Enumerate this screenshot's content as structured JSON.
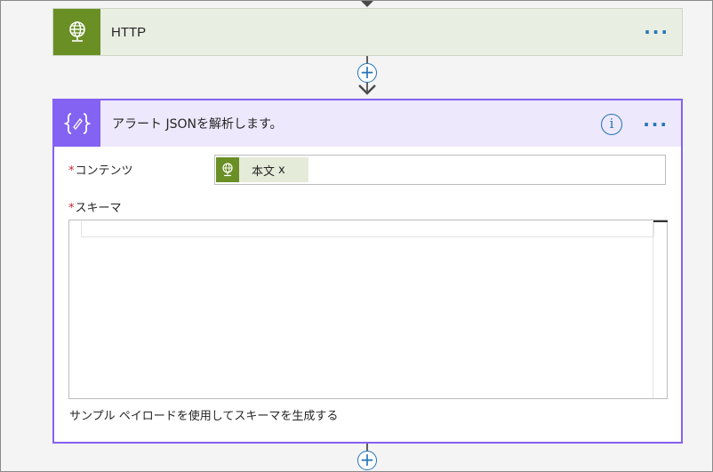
{
  "http_action": {
    "title": "HTTP",
    "icon": "globe-icon",
    "accent": "#6a8f25"
  },
  "parse_json_action": {
    "title": "アラート JSONを解析します。",
    "icon": "curly-braces-icon",
    "accent": "#8462f2",
    "info_label": "i",
    "fields": {
      "content": {
        "label": "コンテンツ",
        "required": "*",
        "token_label": "本文",
        "token_remove": "x",
        "token_icon": "globe-icon"
      },
      "schema": {
        "label": "スキーマ",
        "required": "*",
        "value": ""
      }
    },
    "sample_link": "サンプル ペイロードを使用してスキーマを生成する"
  },
  "menu_glyph": "···",
  "add_step_glyph": "+",
  "colors": {
    "link_blue": "#2373b9",
    "required_red": "#c4262e",
    "canvas": "#f4f4f4"
  }
}
